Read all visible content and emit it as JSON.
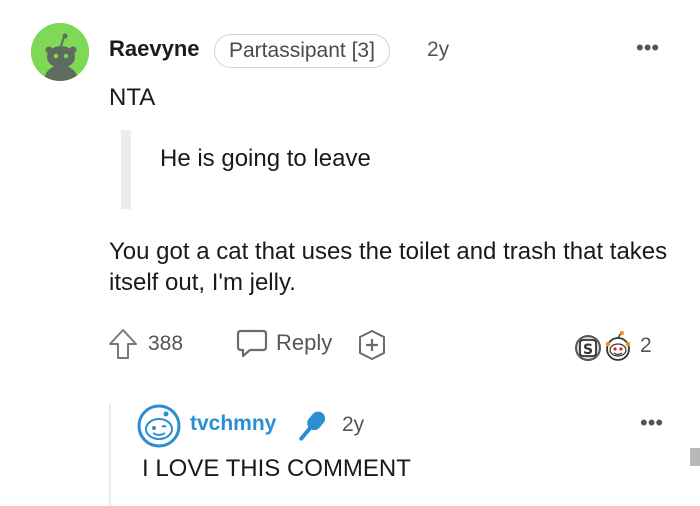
{
  "comment": {
    "username": "Raevyne",
    "flair": "Partassipant [3]",
    "time": "2y",
    "more": "•••",
    "verdict": "NTA",
    "quote": "He is going to leave",
    "body": "You got a cat that uses the toilet and trash that takes itself out, I'm jelly.",
    "score": "388",
    "reply_label": "Reply",
    "award_count": "2",
    "avatar_color": "#7ed957",
    "icons": [
      "avatar-snoo",
      "upvote-arrow-icon",
      "reply-bubble-icon",
      "add-award-icon",
      "awards-icon",
      "more-options-icon"
    ]
  },
  "reply": {
    "username": "tvchmny",
    "time": "2y",
    "more": "•••",
    "body": "I LOVE THIS COMMENT",
    "username_color": "#2a8fd1",
    "icons": [
      "avatar-snoo",
      "microphone-icon",
      "more-options-icon"
    ]
  }
}
